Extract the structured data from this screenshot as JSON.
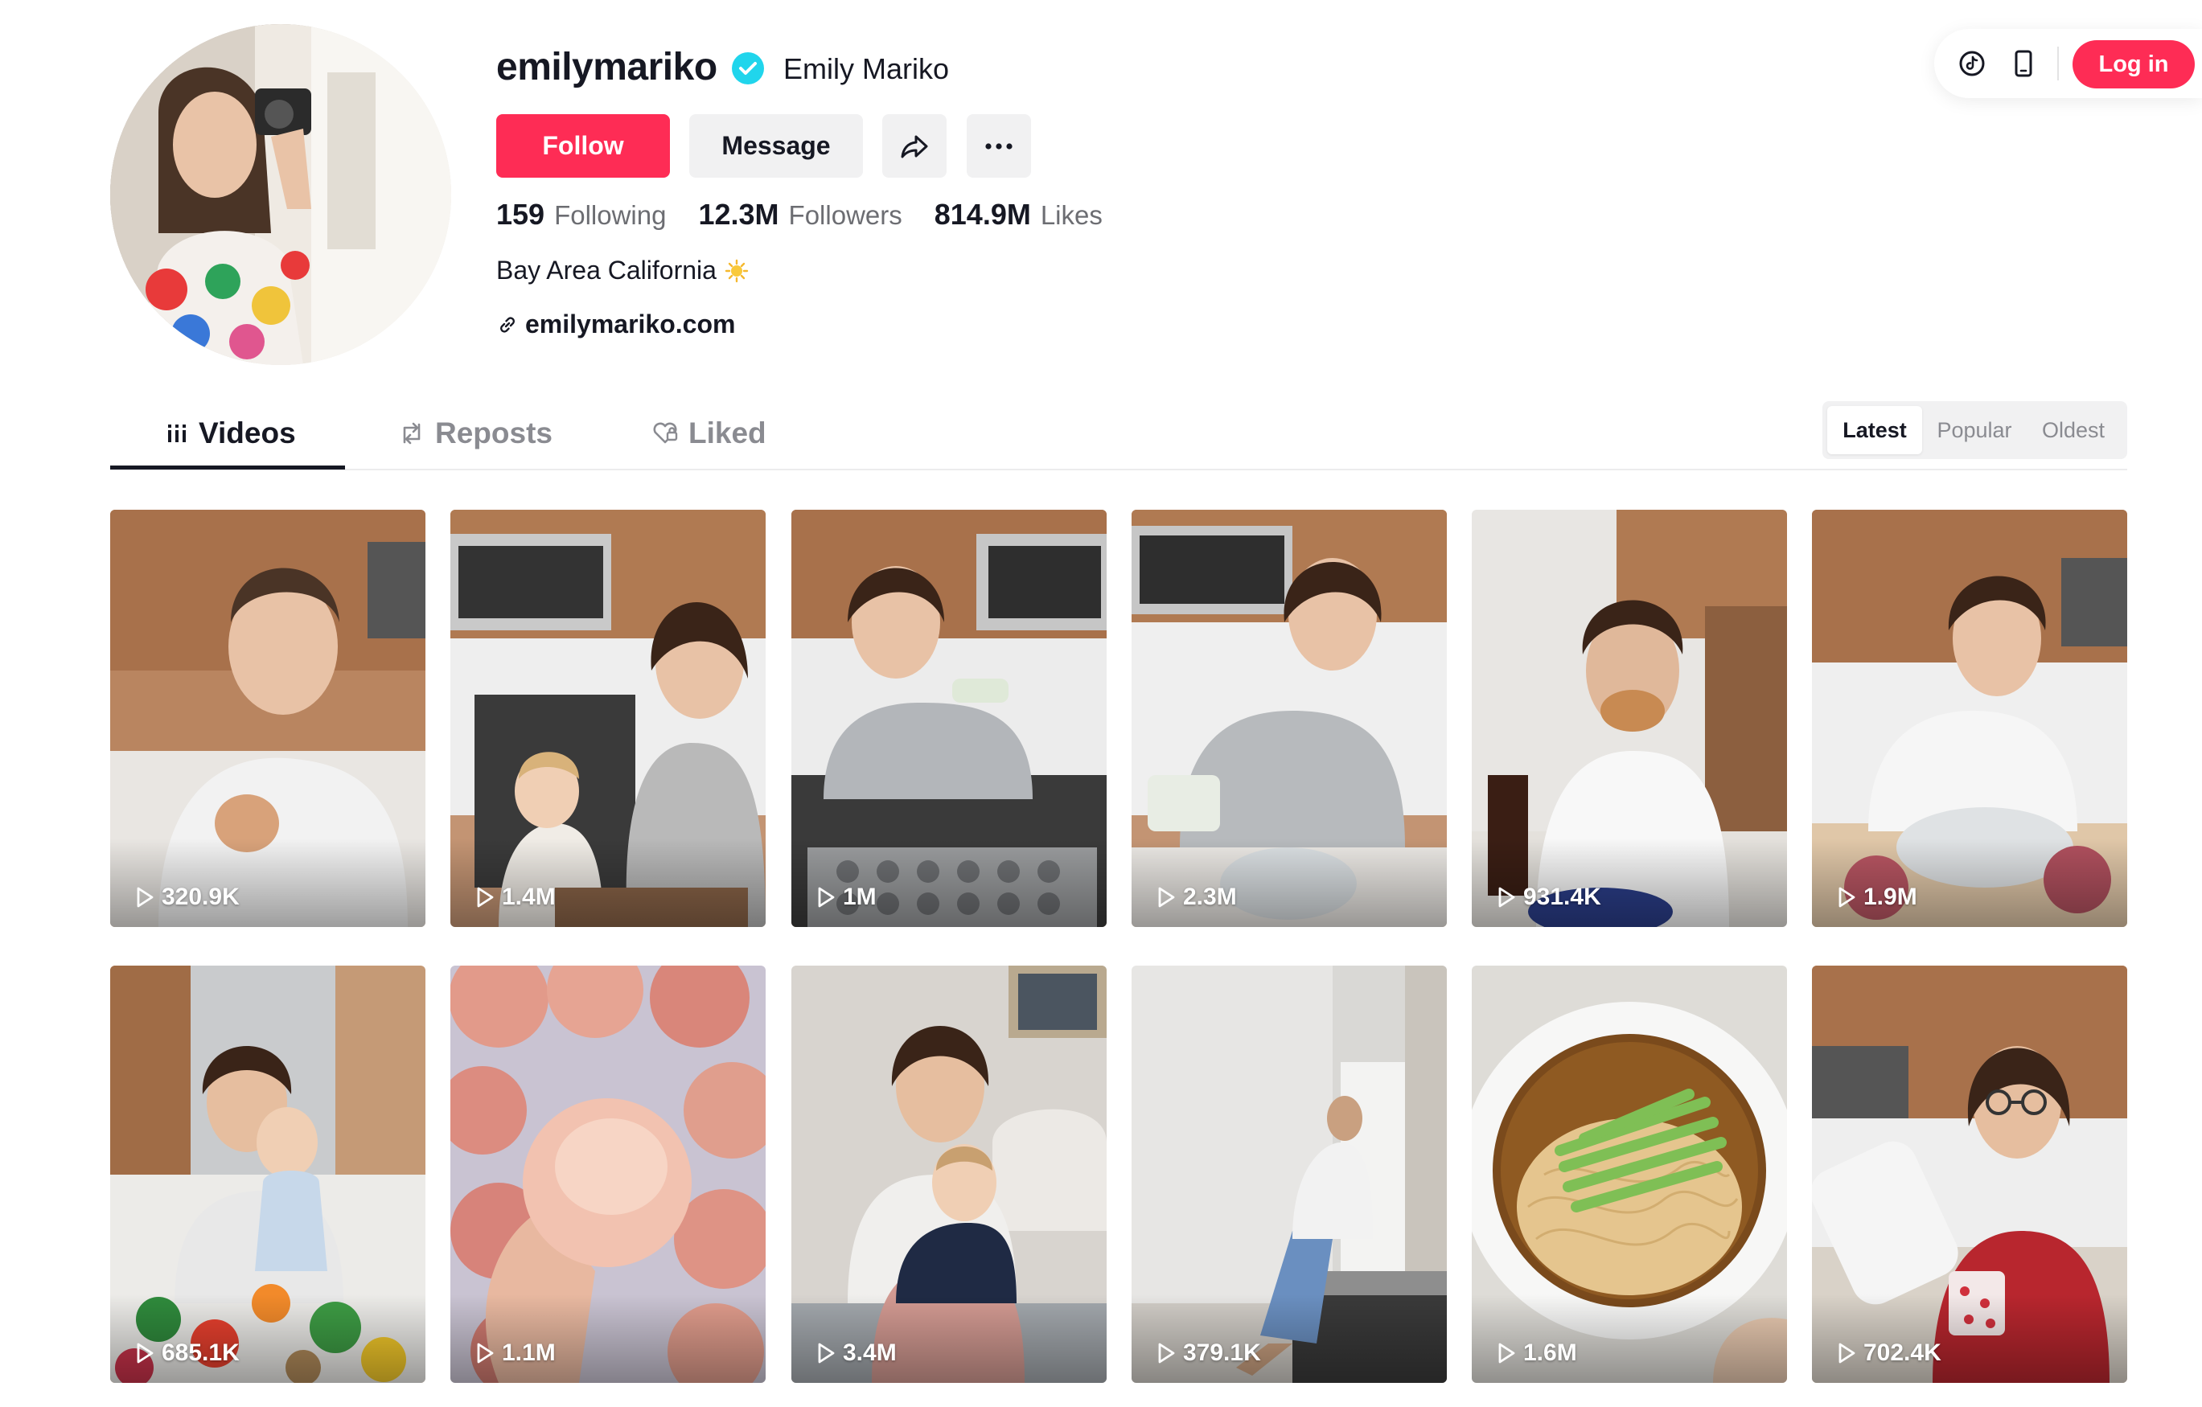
{
  "topbar": {
    "icons": [
      "tiktok-icon",
      "mobile-icon"
    ],
    "login_label": "Log in",
    "accent": "#fe2c55"
  },
  "profile": {
    "username": "emilymariko",
    "verified": true,
    "nickname": "Emily Mariko",
    "follow_label": "Follow",
    "message_label": "Message",
    "share_icon": "share-icon",
    "more_icon": "more-icon",
    "stats": {
      "following_count": "159",
      "following_label": "Following",
      "followers_count": "12.3M",
      "followers_label": "Followers",
      "likes_count": "814.9M",
      "likes_label": "Likes"
    },
    "bio": "Bay Area California",
    "bio_emoji": "sun-icon",
    "link": "emilymariko.com"
  },
  "tabs": [
    {
      "label": "Videos",
      "icon": "grid-icon",
      "active": true
    },
    {
      "label": "Reposts",
      "icon": "repost-icon",
      "active": false
    },
    {
      "label": "Liked",
      "icon": "heart-icon",
      "active": false
    }
  ],
  "sort": {
    "options": [
      "Latest",
      "Popular",
      "Oldest"
    ],
    "selected": "Latest"
  },
  "videos": [
    {
      "views": "320.9K"
    },
    {
      "views": "1.4M"
    },
    {
      "views": "1M"
    },
    {
      "views": "2.3M"
    },
    {
      "views": "931.4K"
    },
    {
      "views": "1.9M"
    },
    {
      "views": "685.1K"
    },
    {
      "views": "1.1M"
    },
    {
      "views": "3.4M"
    },
    {
      "views": "379.1K"
    },
    {
      "views": "1.6M"
    },
    {
      "views": "702.4K"
    }
  ]
}
